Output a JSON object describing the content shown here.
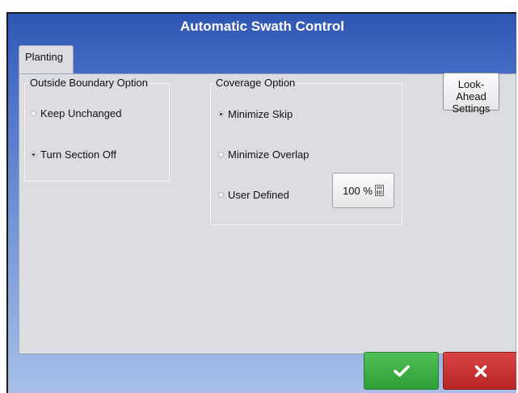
{
  "window": {
    "title": "Automatic Swath Control"
  },
  "tabs": [
    {
      "label": "Planting"
    }
  ],
  "outside_boundary": {
    "legend": "Outside Boundary Option",
    "options": [
      {
        "label": "Keep Unchanged",
        "selected": false
      },
      {
        "label": "Turn Section Off",
        "selected": true
      }
    ]
  },
  "coverage": {
    "legend": "Coverage Option",
    "options": [
      {
        "label": "Minimize Skip",
        "selected": true
      },
      {
        "label": "Minimize Overlap",
        "selected": false
      },
      {
        "label": "User Defined",
        "selected": false
      }
    ],
    "user_defined_value": "100 %"
  },
  "look_ahead_button": {
    "line1": "Look-Ahead",
    "line2": "Settings"
  },
  "actions": {
    "ok_icon": "checkmark-icon",
    "cancel_icon": "x-icon",
    "ok_color": "#3cb043",
    "cancel_color": "#c83232"
  }
}
